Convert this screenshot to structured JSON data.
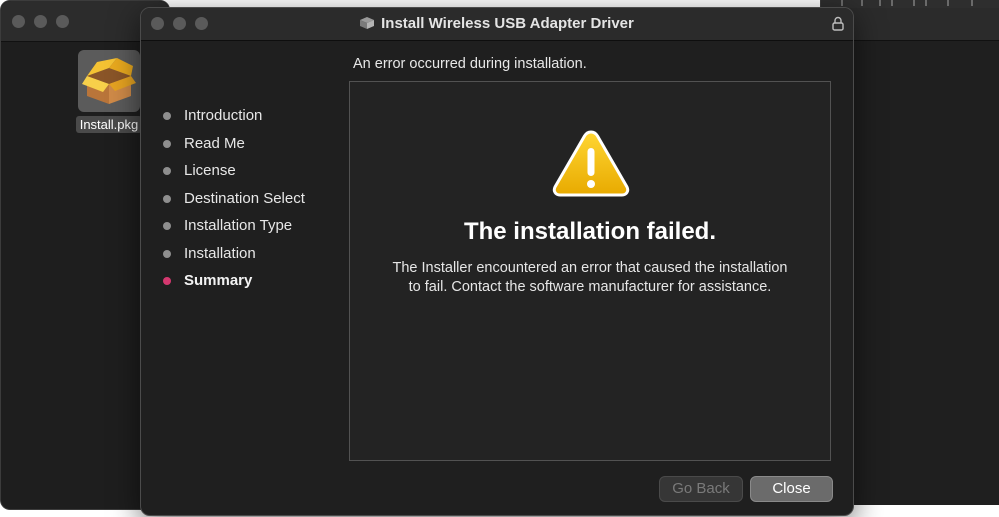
{
  "window": {
    "title": "Install Wireless USB Adapter Driver"
  },
  "desktop": {
    "icon_label": "Install.pkg"
  },
  "header": {
    "message": "An error occurred during installation."
  },
  "sidebar": {
    "steps": [
      {
        "label": "Introduction",
        "active": false
      },
      {
        "label": "Read Me",
        "active": false
      },
      {
        "label": "License",
        "active": false
      },
      {
        "label": "Destination Select",
        "active": false
      },
      {
        "label": "Installation Type",
        "active": false
      },
      {
        "label": "Installation",
        "active": false
      },
      {
        "label": "Summary",
        "active": true
      }
    ]
  },
  "result": {
    "title": "The installation failed.",
    "description": "The Installer encountered an error that caused the installation to fail. Contact the software manufacturer for assistance."
  },
  "buttons": {
    "back": "Go Back",
    "close": "Close"
  },
  "colors": {
    "active_step_dot": "#d4386f",
    "inactive_step_dot": "#8e8e8e",
    "warning_yellow": "#f2c200"
  },
  "icons": {
    "package": "package-icon",
    "lock": "lock-icon",
    "warning": "warning-icon"
  }
}
